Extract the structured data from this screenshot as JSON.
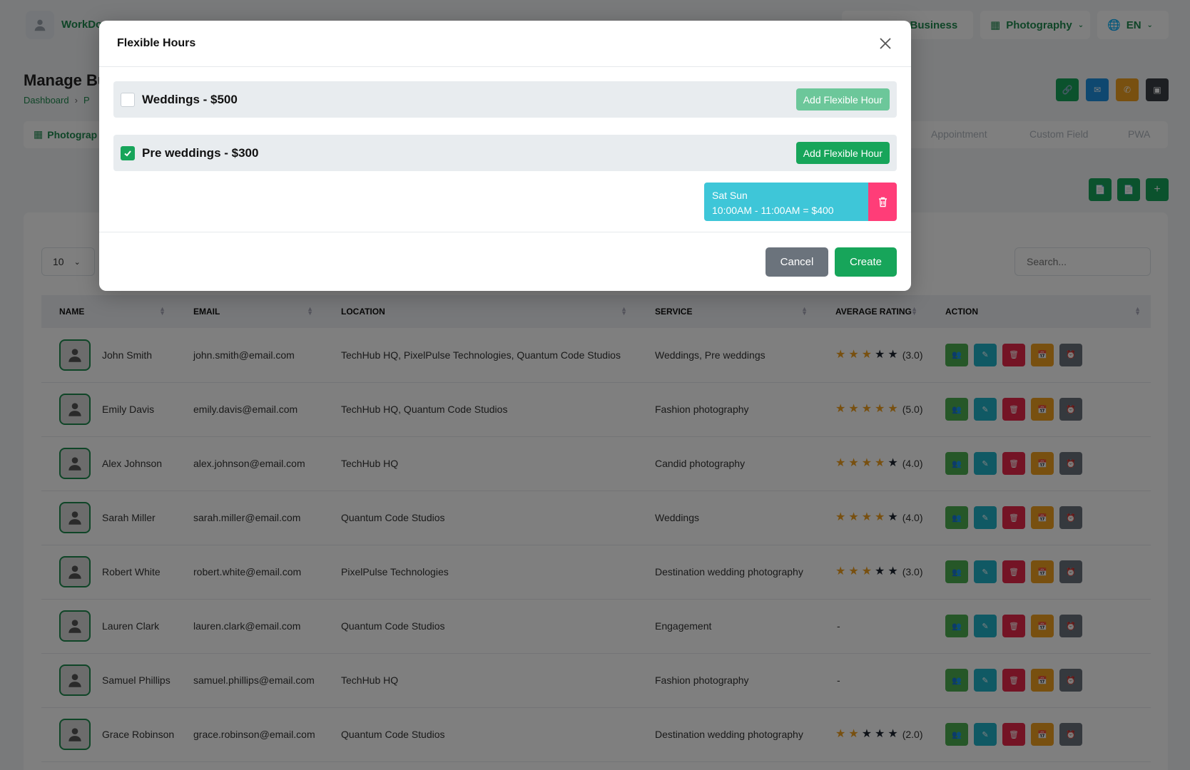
{
  "topbar": {
    "brand": "WorkDo",
    "business_link": "te Business",
    "category": "Photography",
    "language": "EN"
  },
  "page": {
    "title": "Manage Bu",
    "breadcrumb": [
      "Dashboard",
      "P"
    ]
  },
  "tabs": [
    "Photograp",
    "Appointment",
    "Custom Field",
    "PWA"
  ],
  "table": {
    "page_size": "10",
    "search_placeholder": "Search...",
    "columns": [
      "NAME",
      "EMAIL",
      "LOCATION",
      "SERVICE",
      "AVERAGE RATING",
      "ACTION"
    ],
    "rows": [
      {
        "name": "John Smith",
        "email": "john.smith@email.com",
        "location": "TechHub HQ, PixelPulse Technologies, Quantum Code Studios",
        "service": "Weddings, Pre weddings",
        "stars": 3,
        "rating": "(3.0)"
      },
      {
        "name": "Emily Davis",
        "email": "emily.davis@email.com",
        "location": "TechHub HQ, Quantum Code Studios",
        "service": "Fashion photography",
        "stars": 5,
        "rating": "(5.0)"
      },
      {
        "name": "Alex Johnson",
        "email": "alex.johnson@email.com",
        "location": "TechHub HQ",
        "service": "Candid photography",
        "stars": 4,
        "rating": "(4.0)"
      },
      {
        "name": "Sarah Miller",
        "email": "sarah.miller@email.com",
        "location": "Quantum Code Studios",
        "service": "Weddings",
        "stars": 4,
        "rating": "(4.0)"
      },
      {
        "name": "Robert White",
        "email": "robert.white@email.com",
        "location": "PixelPulse Technologies",
        "service": "Destination wedding photography",
        "stars": 3,
        "rating": "(3.0)"
      },
      {
        "name": "Lauren Clark",
        "email": "lauren.clark@email.com",
        "location": "Quantum Code Studios",
        "service": "Engagement",
        "stars": 0,
        "rating": "-"
      },
      {
        "name": "Samuel Phillips",
        "email": "samuel.phillips@email.com",
        "location": "TechHub HQ",
        "service": "Fashion photography",
        "stars": 0,
        "rating": "-"
      },
      {
        "name": "Grace Robinson",
        "email": "grace.robinson@email.com",
        "location": "Quantum Code Studios",
        "service": "Destination wedding photography",
        "stars": 2,
        "rating": "(2.0)"
      }
    ]
  },
  "modal": {
    "title": "Flexible Hours",
    "services": [
      {
        "label": "Weddings - $500",
        "checked": false,
        "button": "Add Flexible Hour"
      },
      {
        "label": "Pre weddings - $300",
        "checked": true,
        "button": "Add Flexible Hour"
      }
    ],
    "slot": {
      "days": "Sat Sun",
      "time": "10:00AM - 11:00AM = $400"
    },
    "cancel_label": "Cancel",
    "create_label": "Create"
  },
  "colors": {
    "primary": "#17a55a",
    "slot": "#3ec6d8",
    "danger": "#ff3d78",
    "action_green": "#4caf50",
    "action_cyan": "#20b3c9",
    "action_red": "#e8294a",
    "action_orange": "#f0a020",
    "action_dark": "#6b737c"
  }
}
